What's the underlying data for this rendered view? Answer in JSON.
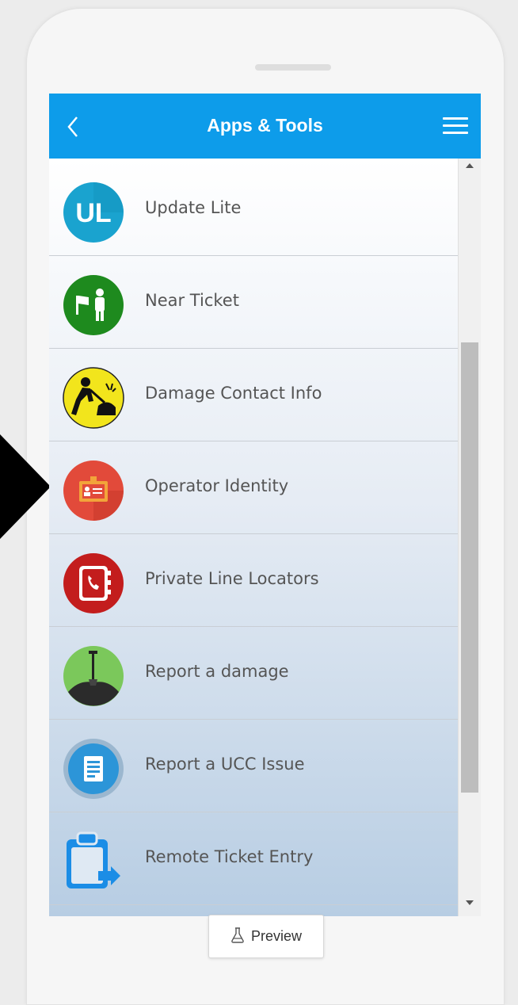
{
  "header": {
    "title": "Apps & Tools",
    "back_icon": "chevron-left-icon",
    "menu_icon": "hamburger-menu-icon"
  },
  "items": [
    {
      "label": "Update Lite",
      "icon": "update-lite-icon",
      "icon_text": "UL"
    },
    {
      "label": "Near Ticket",
      "icon": "near-ticket-icon"
    },
    {
      "label": "Damage Contact Info",
      "icon": "damage-contact-icon"
    },
    {
      "label": "Operator Identity",
      "icon": "operator-identity-icon"
    },
    {
      "label": "Private Line Locators",
      "icon": "private-line-locators-icon"
    },
    {
      "label": "Report a damage",
      "icon": "report-damage-icon"
    },
    {
      "label": "Report a UCC Issue",
      "icon": "report-ucc-issue-icon"
    },
    {
      "label": "Remote Ticket Entry",
      "icon": "remote-ticket-entry-icon"
    }
  ],
  "footer": {
    "preview_label": "Preview",
    "preview_icon": "flask-icon"
  },
  "colors": {
    "header": "#0d9cea",
    "update_lite": "#1aa3cf",
    "near_ticket": "#1e8a1e",
    "damage_contact": "#f2e51c",
    "operator_identity": "#e24a3a",
    "private_line": "#c31d1d",
    "report_damage": "#7bc85b",
    "report_ucc": "#2c95d8",
    "remote_ticket": "#1b8de6"
  }
}
